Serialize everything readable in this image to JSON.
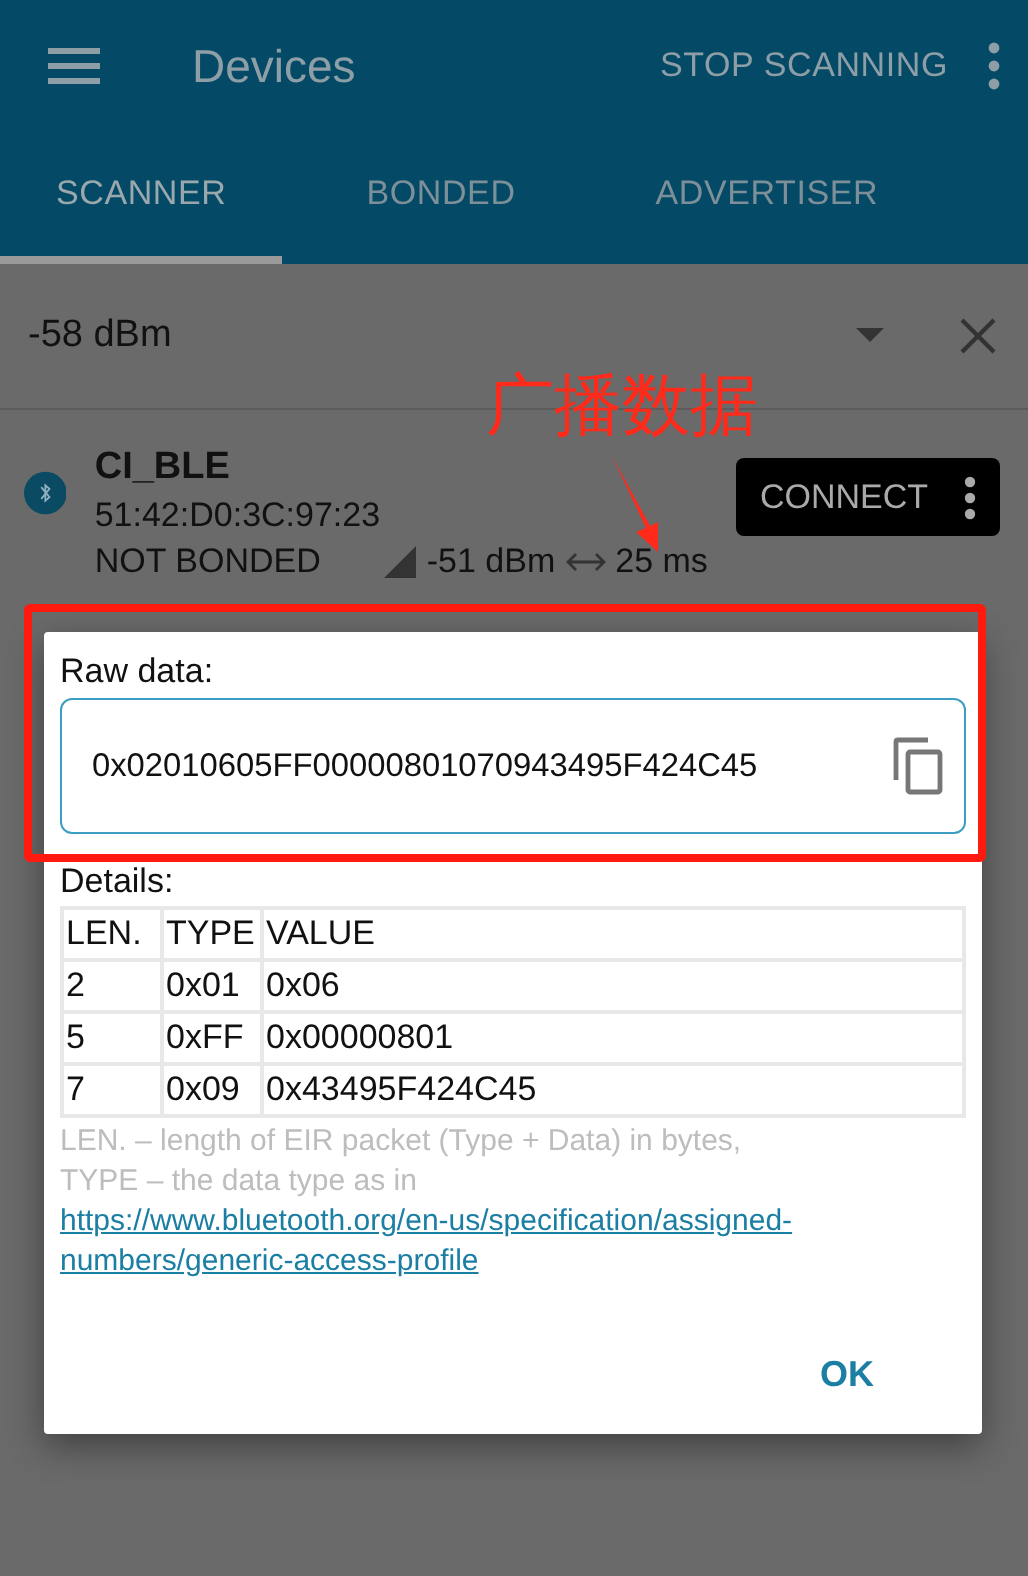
{
  "app_bar": {
    "title": "Devices",
    "action": "STOP SCANNING"
  },
  "tabs": [
    {
      "label": "SCANNER",
      "selected": true
    },
    {
      "label": "BONDED",
      "selected": false
    },
    {
      "label": "ADVERTISER",
      "selected": false
    }
  ],
  "filter": {
    "value": "-58 dBm"
  },
  "devices": [
    {
      "name": "CI_BLE",
      "address": "51:42:D0:3C:97:23",
      "bond_state": "NOT BONDED",
      "rssi": "-51 dBm",
      "interval": "25 ms",
      "action": "CONNECT"
    }
  ],
  "dialog": {
    "raw_label": "Raw data:",
    "raw_value": "0x02010605FF00000801070943495F424C45",
    "details_label": "Details:",
    "columns": [
      "LEN.",
      "TYPE",
      "VALUE"
    ],
    "rows": [
      [
        "2",
        "0x01",
        "0x06"
      ],
      [
        "5",
        "0xFF",
        "0x00000801"
      ],
      [
        "7",
        "0x09",
        "0x43495F424C45"
      ]
    ],
    "note": "LEN. – length of EIR packet (Type + Data) in bytes,\nTYPE – the data type as in ",
    "link": "https://www.bluetooth.org/en-us/specification/assigned-numbers/generic-access-profile",
    "button": "OK"
  },
  "annotation": {
    "text": "广播数据"
  }
}
